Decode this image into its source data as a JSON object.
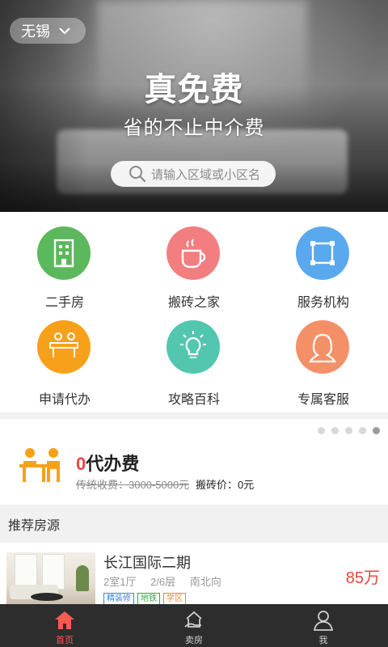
{
  "hero": {
    "city": "无锡",
    "title": "真免费",
    "subtitle": "省的不止中介费",
    "search_placeholder": "请输入区域或小区名"
  },
  "categories": [
    {
      "label": "二手房",
      "icon": "building-icon",
      "color": "#5cb85c"
    },
    {
      "label": "搬砖之家",
      "icon": "coffee-cup-icon",
      "color": "#f27e80"
    },
    {
      "label": "服务机构",
      "icon": "square-frame-icon",
      "color": "#5aa9ee"
    },
    {
      "label": "申请代办",
      "icon": "agent-desk-icon",
      "color": "#f7a11a"
    },
    {
      "label": "攻略百科",
      "icon": "lightbulb-icon",
      "color": "#53c6b0"
    },
    {
      "label": "专属客服",
      "icon": "customer-service-icon",
      "color": "#f49068"
    }
  ],
  "promo": {
    "title_zero": "0",
    "title_rest": "代办费",
    "old_price": "传统收费：3000-5000元",
    "new_price": "搬砖价：0元",
    "carousel_dots": 5,
    "active_dot": 4
  },
  "section": {
    "title": "推荐房源"
  },
  "listings": [
    {
      "title": "长江国际二期",
      "layout": "2室1厅",
      "floor": "2/6层",
      "orientation": "南北向",
      "tags": [
        "精装修",
        "地铁",
        "学区"
      ],
      "price": "85万"
    }
  ],
  "tabs": [
    {
      "label": "首页",
      "icon": "home-icon",
      "active": true
    },
    {
      "label": "卖房",
      "icon": "sell-house-icon",
      "active": false
    },
    {
      "label": "我",
      "icon": "user-icon",
      "active": false
    }
  ],
  "colors": {
    "accent_red": "#e8463d",
    "tab_active": "#ff5a52",
    "tabbar_bg": "#2d2d2d"
  }
}
